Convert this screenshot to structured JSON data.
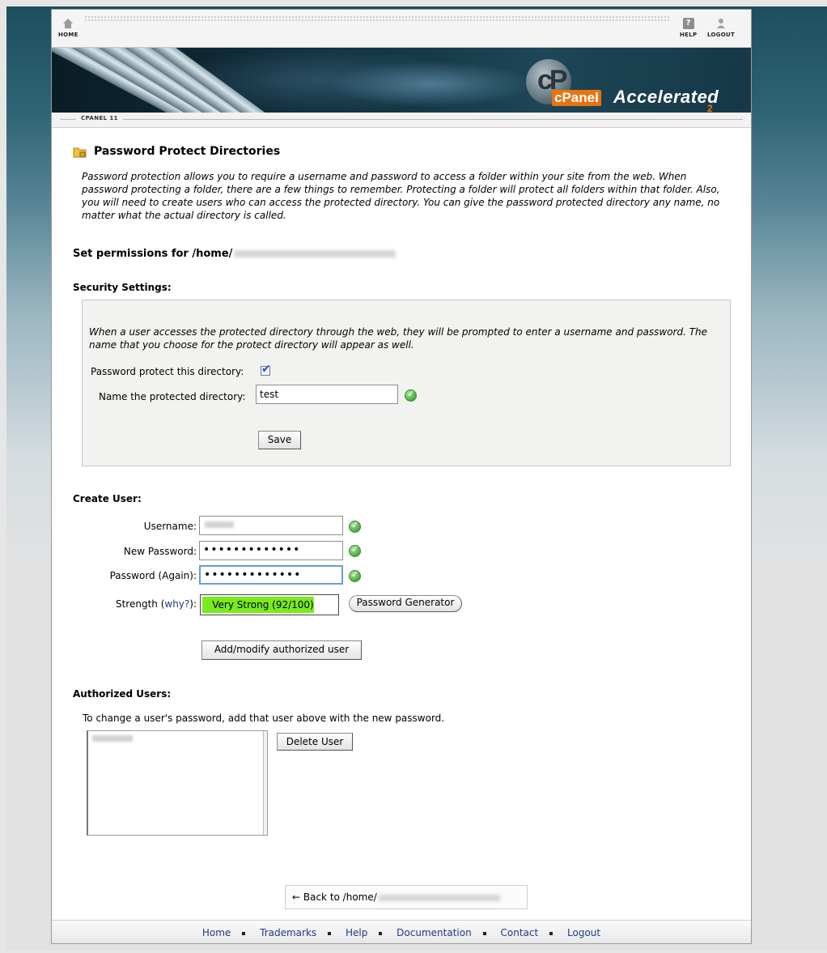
{
  "nav": {
    "home": "HOME",
    "help": "HELP",
    "logout": "LOGOUT"
  },
  "banner": {
    "cp": "cP",
    "panel": "cPanel",
    "accelerated": "Accelerated",
    "version_sub": "2"
  },
  "crumb": "CPANEL 11",
  "page_title": "Password Protect Directories",
  "intro": "Password protection allows you to require a username and password to access a folder within your site from the web. When password protecting a folder, there are a few things to remember. Protecting a folder will protect all folders within that folder. Also, you will need to create users who can access the protected directory. You can give the password protected directory any name, no matter what the actual directory is called.",
  "permissions": {
    "label": "Set permissions for /home/"
  },
  "security": {
    "heading": "Security Settings:",
    "description": "When a user accesses the protected directory through the web, they will be prompted to enter a username and password. The name that you choose for the protect directory will appear as well.",
    "protect_label": "Password protect this directory:",
    "protect_checked": true,
    "name_label": "Name the protected directory:",
    "name_value": "test",
    "save_label": "Save"
  },
  "create_user": {
    "heading": "Create User:",
    "username_label": "Username:",
    "new_password_label": "New Password:",
    "new_password_value": "•••••••••••••",
    "password_again_label": "Password (Again):",
    "password_again_value": "•••••••••••••",
    "strength_label": "Strength (",
    "strength_why": "why?",
    "strength_close": "):",
    "strength_text": "Very Strong (92/100)",
    "strength_score": 92,
    "generator_label": "Password Generator",
    "add_label": "Add/modify authorized user"
  },
  "authorized": {
    "heading": "Authorized Users:",
    "note": "To change a user's password, add that user above with the new password.",
    "delete_label": "Delete User"
  },
  "back_link": "← Back to /home/",
  "footer": {
    "links": [
      "Home",
      "Trademarks",
      "Help",
      "Documentation",
      "Contact",
      "Logout"
    ]
  },
  "colors": {
    "strength_fill": "#7aeb1c",
    "link": "#203a8a",
    "cpanel_orange": "#e8730f"
  }
}
